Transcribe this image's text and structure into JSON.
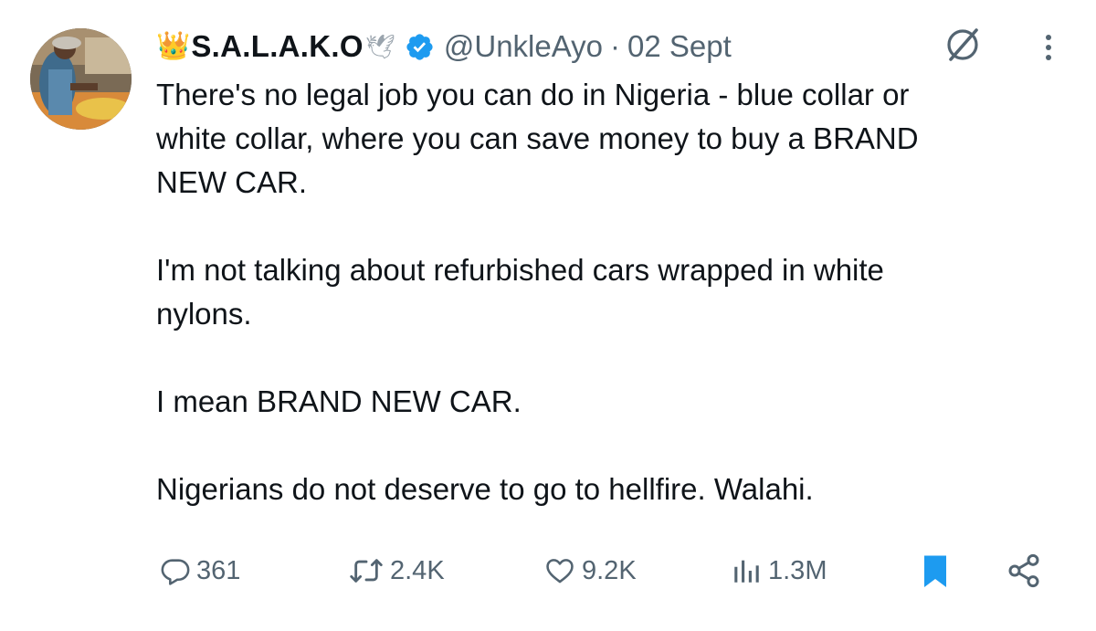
{
  "tweet": {
    "author": {
      "crown": "👑",
      "display_name": "S.A.L.A.K.O",
      "dove": "🕊",
      "handle": "@UnkleAyo",
      "date_separator": "·",
      "date": "02 Sept"
    },
    "text": "There's no legal job you can do in Nigeria - blue collar or\nwhite collar, where you can save money to buy a BRAND\nNEW CAR.\n\nI'm not talking about refurbished cars wrapped in white\nnylons.\n\nI mean BRAND NEW CAR.\n\nNigerians do not deserve to go to hellfire. Walahi.",
    "stats": {
      "replies": "361",
      "reposts": "2.4K",
      "likes": "9.2K",
      "views": "1.3M"
    },
    "bookmarked": true
  },
  "colors": {
    "text": "#0f1419",
    "secondary": "#536471",
    "accent_blue": "#1d9bf0",
    "background": "#ffffff"
  },
  "icons": {
    "verified": "verified-badge-icon",
    "grok": "grok-icon",
    "more": "more-vertical-icon",
    "reply": "reply-icon",
    "repost": "repost-icon",
    "like": "heart-icon",
    "views": "views-chart-icon",
    "bookmark": "bookmark-icon",
    "share": "share-icon"
  }
}
